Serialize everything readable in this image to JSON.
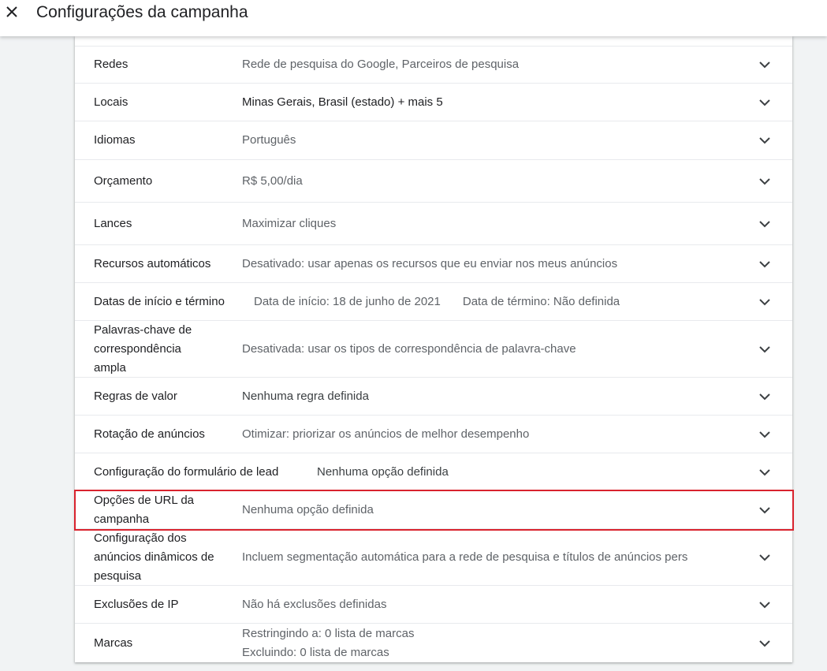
{
  "header": {
    "title": "Configurações da campanha",
    "close_icon": "close-icon"
  },
  "rows": [
    {
      "label": "Redes",
      "value": "Rede de pesquisa do Google, Parceiros de pesquisa"
    },
    {
      "label": "Locais",
      "value": "Minas Gerais, Brasil (estado) + mais 5"
    },
    {
      "label": "Idiomas",
      "value": "Português"
    },
    {
      "label": "Orçamento",
      "value": "R$ 5,00/dia"
    },
    {
      "label": "Lances",
      "value": "Maximizar cliques"
    },
    {
      "label": "Recursos automáticos",
      "value": "Desativado: usar apenas os recursos que eu enviar nos meus anúncios"
    },
    {
      "label": "Datas de início e término",
      "value_start": "Data de início: 18 de junho de 2021",
      "value_end": "Data de término: Não definida"
    },
    {
      "label_lines": [
        "Palavras-chave de",
        "correspondência",
        "ampla"
      ],
      "value": "Desativada: usar os tipos de correspondência de palavra-chave"
    },
    {
      "label": "Regras de valor",
      "value": "Nenhuma regra definida"
    },
    {
      "label": "Rotação de anúncios",
      "value": "Otimizar: priorizar os anúncios de melhor desempenho"
    },
    {
      "label": "Configuração do formulário de lead",
      "value": "Nenhuma opção definida"
    },
    {
      "label_lines": [
        "Opções de URL da",
        "campanha"
      ],
      "value": "Nenhuma opção definida"
    },
    {
      "label_lines": [
        "Configuração dos",
        "anúncios dinâmicos de",
        "pesquisa"
      ],
      "value": "Incluem segmentação automática para a rede de pesquisa e títulos de anúncios pers"
    },
    {
      "label": "Exclusões de IP",
      "value": "Não há exclusões definidas"
    },
    {
      "label": "Marcas",
      "value_lines": [
        "Restringindo a: 0 lista de marcas",
        "Excluindo: 0 lista de marcas"
      ]
    }
  ],
  "colors": {
    "highlight": "#d9232e",
    "label_text": "#202124",
    "value_text": "#5f6368"
  },
  "chevron_icon": "chevron-down-icon"
}
